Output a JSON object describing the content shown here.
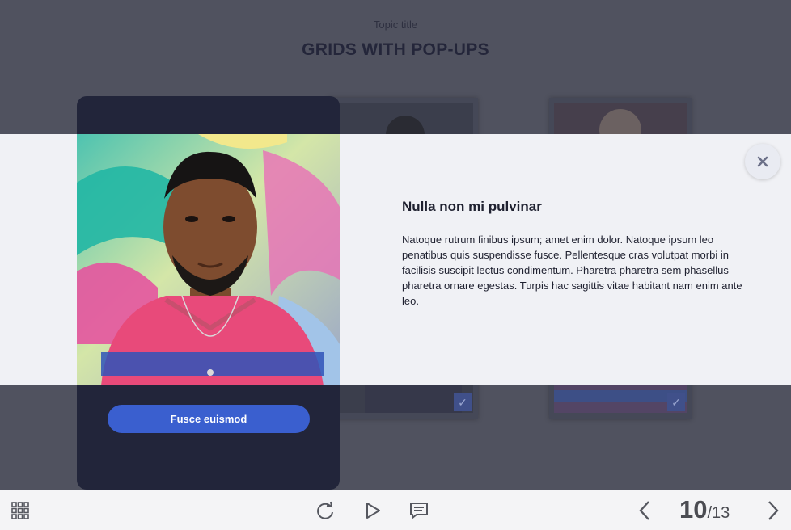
{
  "slide": {
    "topic_label": "Topic title",
    "title": "GRIDS WITH POP-UPS"
  },
  "popup": {
    "heading": "Nulla non mi pulvinar",
    "body": "Natoque rutrum finibus ipsum; amet enim dolor. Natoque ipsum leo penatibus quis suspendisse fusce. Pellentesque cras volutpat morbi in facilisis suscipit lectus condimentum. Pharetra pharetra sem phasellus pharetra ornare egestas. Turpis hac sagittis vitae habitant nam enim ante leo.",
    "button_label": "Fusce euismod",
    "close_icon": "close-icon"
  },
  "toolbar": {
    "menu_icon": "grid-menu-icon",
    "replay_icon": "replay-icon",
    "play_icon": "play-icon",
    "notes_icon": "notes-icon",
    "prev_icon": "chevron-left-icon",
    "next_icon": "chevron-right-icon",
    "current_slide": "10",
    "total_slides": "/13"
  },
  "colors": {
    "accent": "#3a5fcf",
    "card_dark": "#22253a",
    "band": "#f0f1f5",
    "overlay": "#50525f"
  }
}
